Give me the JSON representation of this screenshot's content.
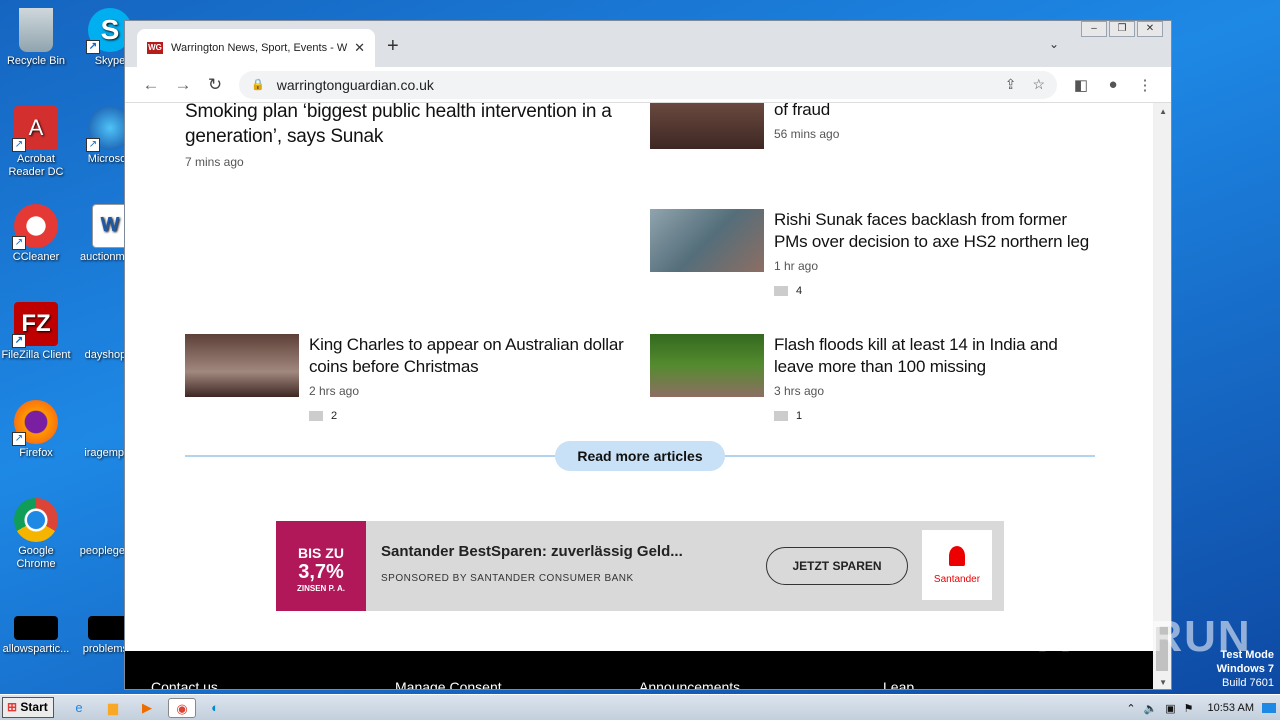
{
  "desktop": {
    "icons": [
      {
        "label": "Recycle Bin"
      },
      {
        "label": "Skype"
      },
      {
        "label": "Acrobat Reader DC"
      },
      {
        "label": "Microsoft"
      },
      {
        "label": "CCleaner"
      },
      {
        "label": "auctionme..."
      },
      {
        "label": "FileZilla Client"
      },
      {
        "label": "dayshop..."
      },
      {
        "label": "Firefox"
      },
      {
        "label": "iragempl..."
      },
      {
        "label": "Google Chrome"
      },
      {
        "label": "peoplegen..."
      },
      {
        "label": "allowspartic..."
      },
      {
        "label": "problems..."
      }
    ]
  },
  "browser": {
    "tab_title": "Warrington News, Sport, Events - W",
    "favicon_text": "WG",
    "url": "warringtonguardian.co.uk"
  },
  "articles": {
    "a1": {
      "title": "Smoking plan ‘biggest public health intervention in a generation’, says Sunak",
      "time": "7 mins ago"
    },
    "a2": {
      "title": "of fraud",
      "time": "56 mins ago"
    },
    "a3": {
      "title": "Rishi Sunak faces backlash from former PMs over decision to axe HS2 northern leg",
      "time": "1 hr ago",
      "comments": "4"
    },
    "a4": {
      "title": "King Charles to appear on Australian dollar coins before Christmas",
      "time": "2 hrs ago",
      "comments": "2"
    },
    "a5": {
      "title": "Flash floods kill at least 14 in India and leave more than 100 missing",
      "time": "3 hrs ago",
      "comments": "1"
    }
  },
  "read_more": "Read more articles",
  "ad": {
    "image_text_line1": "BIS ZU",
    "image_text_line2": "3,7%",
    "image_text_line3": "ZINSEN P. A.",
    "title": "Santander BestSparen: zuverlässig Geld...",
    "sponsor": "SPONSORED BY SANTANDER CONSUMER BANK",
    "cta": "JETZT SPAREN",
    "logo_text": "Santander"
  },
  "footer": {
    "links": [
      "Contact us",
      "Manage Consent",
      "Announcements",
      "Leap"
    ]
  },
  "watermark": {
    "brand": "ANY RUN",
    "mode": "Test Mode",
    "os": "Windows 7",
    "build": "Build 7601"
  },
  "taskbar": {
    "start_label": "Start",
    "clock": "10:53 AM"
  },
  "colors": {
    "read_more_bg": "#c8e1f6",
    "ad_accent": "#b0185a",
    "santander_red": "#ec0000"
  }
}
